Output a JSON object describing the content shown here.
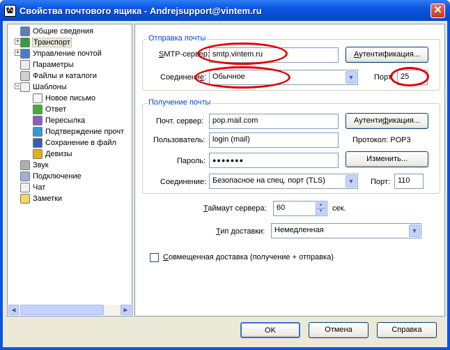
{
  "window": {
    "title": "Свойства почтового ящика - Andrejsupport@vintem.ru",
    "close_glyph": "✕"
  },
  "tree": {
    "items": [
      {
        "label": "Общие сведения",
        "icon": "mailbox-icon",
        "color": "#5b7fbf"
      },
      {
        "label": "Транспорт",
        "icon": "transport-icon",
        "color": "#3b9a3b",
        "selected": true
      },
      {
        "label": "Управление почтой",
        "icon": "mail-manage-icon",
        "color": "#4c7cc9"
      },
      {
        "label": "Параметры",
        "icon": "settings-icon",
        "color": "#ececec"
      },
      {
        "label": "Файлы и каталоги",
        "icon": "files-icon",
        "color": "#d0d0d0"
      },
      {
        "label": "Шаблоны",
        "icon": "templates-icon",
        "color": "#f0f0f0"
      },
      {
        "label": "Новое письмо",
        "icon": "new-letter-icon",
        "color": "#f5f5f5"
      },
      {
        "label": "Ответ",
        "icon": "reply-icon",
        "color": "#3fae3f"
      },
      {
        "label": "Пересылка",
        "icon": "forward-icon",
        "color": "#8a5fbf"
      },
      {
        "label": "Подтверждение прочт",
        "icon": "confirm-icon",
        "color": "#2e9ad6"
      },
      {
        "label": "Сохранение в файл",
        "icon": "save-icon",
        "color": "#3a5fa8"
      },
      {
        "label": "Девизы",
        "icon": "mottos-icon",
        "color": "#e0b020"
      },
      {
        "label": "Звук",
        "icon": "sound-icon",
        "color": "#b0b0b0"
      },
      {
        "label": "Подключение",
        "icon": "connection-icon",
        "color": "#9bb3d8"
      },
      {
        "label": "Чат",
        "icon": "chat-icon",
        "color": "#f0f0f0"
      },
      {
        "label": "Заметки",
        "icon": "notes-icon",
        "color": "#f6d560"
      }
    ]
  },
  "send": {
    "legend": "Отправка почты",
    "smtp_label_pre": "S",
    "smtp_label_post": "MTP-сервер:",
    "smtp_value": "smtp.vintem.ru",
    "auth_pre": "А",
    "auth_post": "утентификация...",
    "conn_label_pre": "Соединени",
    "conn_label_u": "е",
    "conn_label_post": ":",
    "conn_value": "Обычное",
    "port_label": "Порт:",
    "port_value": "25"
  },
  "receive": {
    "legend": "Получение почты",
    "server_label": "Почт. сервер:",
    "server_value": "pop.mail.com",
    "auth_pre": "Аутенти",
    "auth_u": "ф",
    "auth_post": "икация...",
    "user_label": "Пользователь:",
    "user_value": "login (mail)",
    "protocol_text": "Протокол:  POP3",
    "password_label": "Пароль:",
    "password_value": "●●●●●●●",
    "change_label": "Изменить...",
    "conn_label": "Соединение:",
    "conn_value": "Безопасное на спец. порт (TLS)",
    "port_label": "Порт:",
    "port_value": "110"
  },
  "timeout": {
    "label_u": "Т",
    "label_rest": "аймаут сервера:",
    "value": "60",
    "unit": "сек."
  },
  "delivery": {
    "label_u": "Т",
    "label_rest": "ип доставки:",
    "value": "Немедленная"
  },
  "combined": {
    "label_u": "С",
    "label_rest": "овмещенная доставка (получение + отправка)",
    "checked": false
  },
  "buttons": {
    "ok": "OK",
    "cancel": "Отмена",
    "help": "Справка"
  },
  "colors": {
    "accent": "#0046d5",
    "annotation": "#e00000",
    "titlebar": "#0a55e0"
  }
}
